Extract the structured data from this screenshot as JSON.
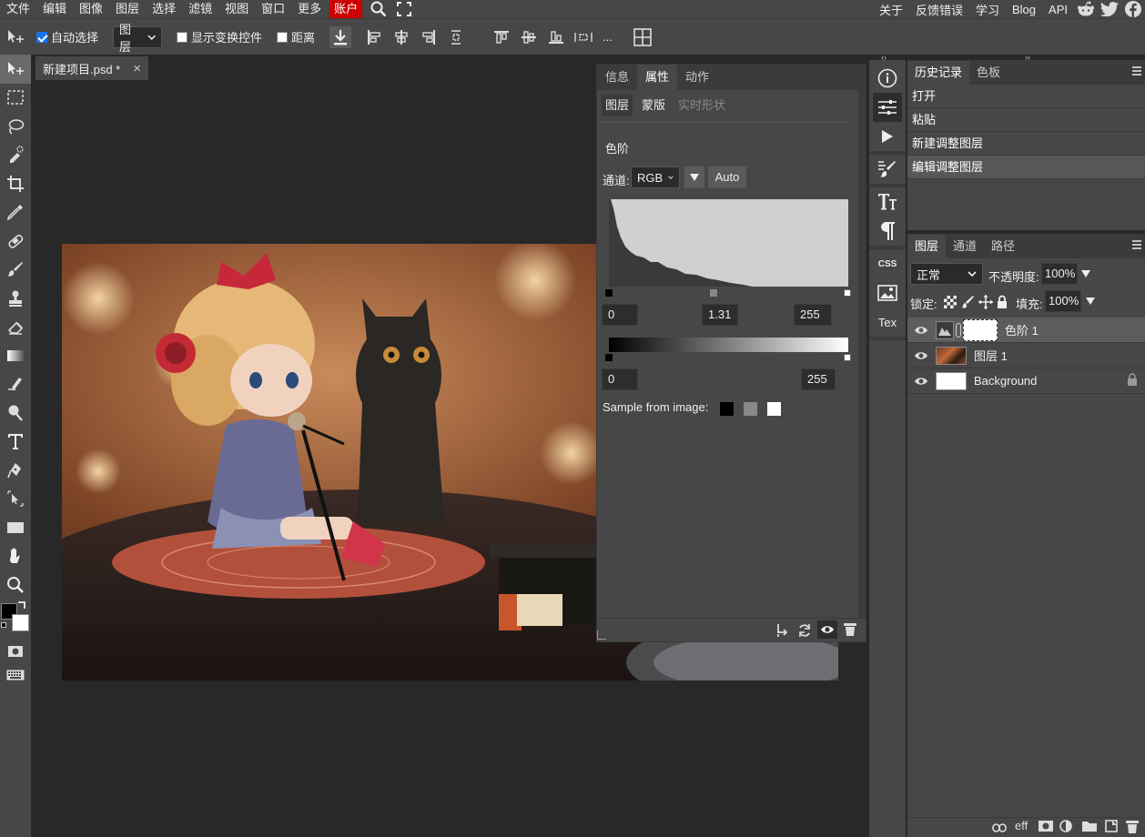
{
  "menubar": {
    "items": [
      "文件",
      "编辑",
      "图像",
      "图层",
      "选择",
      "滤镜",
      "视图",
      "窗口",
      "更多"
    ],
    "account": "账户",
    "right_links": [
      "关于",
      "反馈错误",
      "学习",
      "Blog",
      "API"
    ]
  },
  "options": {
    "auto_select_label": "自动选择",
    "auto_select_checked": true,
    "target_select": "图层",
    "show_transform_label": "显示变换控件",
    "show_transform_checked": false,
    "distance_label": "距离",
    "distance_checked": false,
    "more_label": "..."
  },
  "document": {
    "tab_title": "新建项目.psd *",
    "close_glyph": "×"
  },
  "properties": {
    "tabs": [
      "信息",
      "属性",
      "动作"
    ],
    "active_tab": "属性",
    "subtabs": [
      "图层",
      "蒙版",
      "实时形状"
    ],
    "section_title": "色阶",
    "channel_label": "通道:",
    "channel_value": "RGB",
    "auto_label": "Auto",
    "input_black": "0",
    "input_gamma": "1.31",
    "input_white": "255",
    "output_black": "0",
    "output_white": "255",
    "sample_label": "Sample from image:"
  },
  "iconstrip": {
    "css_label": "CSS",
    "tex_label": "Tex"
  },
  "history": {
    "tabs": [
      "历史记录",
      "色板"
    ],
    "rows": [
      "打开",
      "粘贴",
      "新建调整图层",
      "编辑调整图层"
    ]
  },
  "layers": {
    "tabs": [
      "图层",
      "通道",
      "路径"
    ],
    "blend_mode": "正常",
    "opacity_label": "不透明度:",
    "opacity_value": "100%",
    "lock_label": "锁定:",
    "fill_label": "填充:",
    "fill_value": "100%",
    "rows": [
      {
        "name": "色阶 1",
        "selected": true
      },
      {
        "name": "图层 1",
        "selected": false
      },
      {
        "name": "Background",
        "selected": false
      }
    ],
    "footer_eff": "eff"
  },
  "colors": {
    "accent_red": "#cc0000",
    "panel_bg": "#474747",
    "canvas_bg": "#282828"
  }
}
